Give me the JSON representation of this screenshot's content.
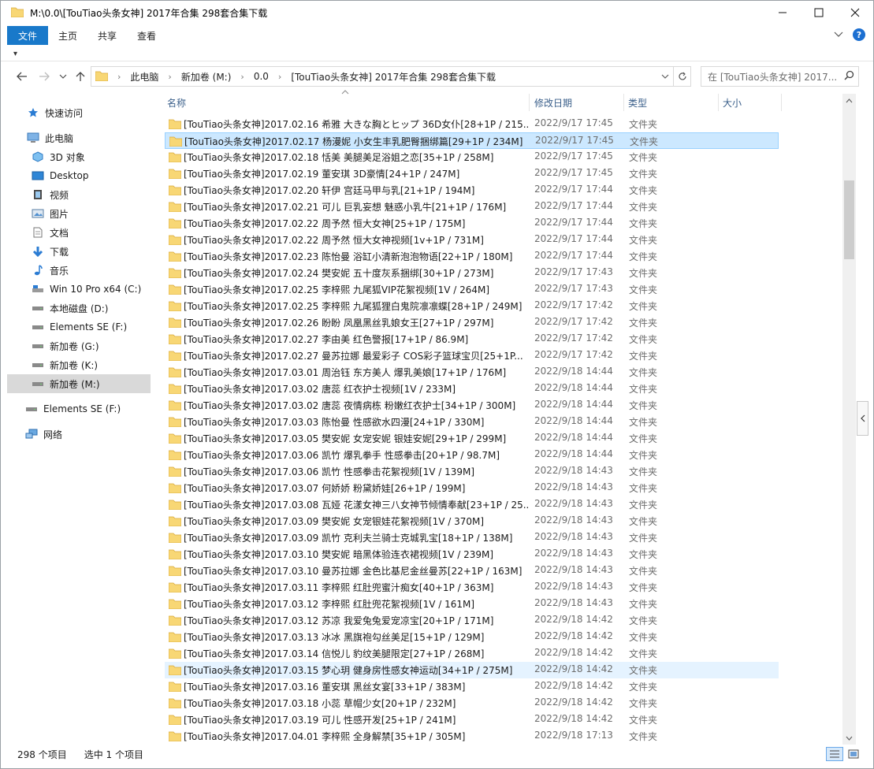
{
  "window": {
    "title": "M:\\0.0\\[TouTiao头条女神] 2017年合集 298套合集下载"
  },
  "ribbon": {
    "tabs": [
      "文件",
      "主页",
      "共享",
      "查看"
    ],
    "qat_label": "▾"
  },
  "address": {
    "crumbs": [
      "此电脑",
      "新加卷 (M:)",
      "0.0",
      "[TouTiao头条女神] 2017年合集 298套合集下载"
    ],
    "search_placeholder": "在 [TouTiao头条女神] 2017..."
  },
  "navpane": {
    "items": [
      {
        "label": "快速访问",
        "icon": "star-icon"
      },
      {
        "label": "此电脑",
        "icon": "computer-icon"
      },
      {
        "label": "3D 对象",
        "icon": "cube-icon"
      },
      {
        "label": "Desktop",
        "icon": "desktop-icon"
      },
      {
        "label": "视频",
        "icon": "video-icon"
      },
      {
        "label": "图片",
        "icon": "picture-icon"
      },
      {
        "label": "文档",
        "icon": "document-icon"
      },
      {
        "label": "下载",
        "icon": "download-icon"
      },
      {
        "label": "音乐",
        "icon": "music-icon"
      },
      {
        "label": "Win 10 Pro x64 (C:)",
        "icon": "system-drive-icon"
      },
      {
        "label": "本地磁盘 (D:)",
        "icon": "drive-icon"
      },
      {
        "label": "Elements SE (F:)",
        "icon": "drive-icon"
      },
      {
        "label": "新加卷 (G:)",
        "icon": "drive-icon"
      },
      {
        "label": "新加卷 (K:)",
        "icon": "drive-icon"
      },
      {
        "label": "新加卷 (M:)",
        "icon": "drive-icon"
      },
      {
        "label": "Elements SE (F:)",
        "icon": "drive-icon"
      },
      {
        "label": "网络",
        "icon": "network-icon"
      }
    ]
  },
  "columns": {
    "name": "名称",
    "date": "修改日期",
    "type": "类型",
    "size": "大小"
  },
  "files": [
    {
      "name": "[TouTiao头条女神]2017.02.16 希雅 大きな胸とヒップ 36D女仆[28+1P / 215...",
      "date": "2022/9/17 17:45",
      "type": "文件夹"
    },
    {
      "name": "[TouTiao头条女神]2017.02.17 杨漫妮 小女生丰乳肥臀捆绑篇[29+1P / 234M]",
      "date": "2022/9/17 17:45",
      "type": "文件夹"
    },
    {
      "name": "[TouTiao头条女神]2017.02.18 恬美 美腿美足浴姐之恋[35+1P / 258M]",
      "date": "2022/9/17 17:45",
      "type": "文件夹"
    },
    {
      "name": "[TouTiao头条女神]2017.02.19 董安琪 3D豪情[24+1P / 247M]",
      "date": "2022/9/17 17:45",
      "type": "文件夹"
    },
    {
      "name": "[TouTiao头条女神]2017.02.20 轩伊 宫廷马甲与乳[21+1P / 194M]",
      "date": "2022/9/17 17:44",
      "type": "文件夹"
    },
    {
      "name": "[TouTiao头条女神]2017.02.21 可儿 巨乳妄想 魅惑小乳牛[21+1P / 176M]",
      "date": "2022/9/17 17:44",
      "type": "文件夹"
    },
    {
      "name": "[TouTiao头条女神]2017.02.22 周予然 恒大女神[25+1P / 175M]",
      "date": "2022/9/17 17:44",
      "type": "文件夹"
    },
    {
      "name": "[TouTiao头条女神]2017.02.22 周予然 恒大女神视频[1v+1P / 731M]",
      "date": "2022/9/17 17:44",
      "type": "文件夹"
    },
    {
      "name": "[TouTiao头条女神]2017.02.23 陈怡曼 浴缸小清新泡泡物语[22+1P / 180M]",
      "date": "2022/9/17 17:44",
      "type": "文件夹"
    },
    {
      "name": "[TouTiao头条女神]2017.02.24 樊安妮 五十度灰系捆绑[30+1P / 273M]",
      "date": "2022/9/17 17:43",
      "type": "文件夹"
    },
    {
      "name": "[TouTiao头条女神]2017.02.25 李梓熙 九尾狐VIP花絮视频[1V / 264M]",
      "date": "2022/9/17 17:43",
      "type": "文件夹"
    },
    {
      "name": "[TouTiao头条女神]2017.02.25 李梓熙 九尾狐狸白鬼院凛凛蝶[28+1P / 249M]",
      "date": "2022/9/17 17:42",
      "type": "文件夹"
    },
    {
      "name": "[TouTiao头条女神]2017.02.26 盼盼 凤凰黑丝乳娘女王[27+1P / 297M]",
      "date": "2022/9/17 17:42",
      "type": "文件夹"
    },
    {
      "name": "[TouTiao头条女神]2017.02.27 李由美 红色警报[17+1P / 86.9M]",
      "date": "2022/9/17 17:42",
      "type": "文件夹"
    },
    {
      "name": "[TouTiao头条女神]2017.02.27 曼苏拉娜 最爱彩子 COS彩子篮球宝贝[25+1P...",
      "date": "2022/9/17 17:42",
      "type": "文件夹"
    },
    {
      "name": "[TouTiao头条女神]2017.03.01 周治钰 东方美人 爆乳美娘[17+1P / 176M]",
      "date": "2022/9/18 14:44",
      "type": "文件夹"
    },
    {
      "name": "[TouTiao头条女神]2017.03.02 唐蕊 红衣护士视频[1V / 233M]",
      "date": "2022/9/18 14:44",
      "type": "文件夹"
    },
    {
      "name": "[TouTiao头条女神]2017.03.02 唐蕊 夜情病栋 粉嫩红衣护士[34+1P / 300M]",
      "date": "2022/9/18 14:44",
      "type": "文件夹"
    },
    {
      "name": "[TouTiao头条女神]2017.03.03 陈怡曼 性感欲水四漫[24+1P / 330M]",
      "date": "2022/9/18 14:44",
      "type": "文件夹"
    },
    {
      "name": "[TouTiao头条女神]2017.03.05 樊安妮 女宠安妮 银娃安妮[29+1P / 299M]",
      "date": "2022/9/18 14:44",
      "type": "文件夹"
    },
    {
      "name": "[TouTiao头条女神]2017.03.06 凯竹 爆乳拳手 性感拳击[20+1P / 98.7M]",
      "date": "2022/9/18 14:44",
      "type": "文件夹"
    },
    {
      "name": "[TouTiao头条女神]2017.03.06 凯竹 性感拳击花絮视频[1V / 139M]",
      "date": "2022/9/18 14:43",
      "type": "文件夹"
    },
    {
      "name": "[TouTiao头条女神]2017.03.07 何娇娇 粉黛娇娃[26+1P / 199M]",
      "date": "2022/9/18 14:43",
      "type": "文件夹"
    },
    {
      "name": "[TouTiao头条女神]2017.03.08 瓦娅 花漾女神三八女神节倾情奉献[23+1P / 25...",
      "date": "2022/9/18 14:43",
      "type": "文件夹"
    },
    {
      "name": "[TouTiao头条女神]2017.03.09 樊安妮 女宠银娃花絮视频[1V / 370M]",
      "date": "2022/9/18 14:43",
      "type": "文件夹"
    },
    {
      "name": "[TouTiao头条女神]2017.03.09 凯竹 克利夫兰骑士克城乳宝[18+1P / 138M]",
      "date": "2022/9/18 14:43",
      "type": "文件夹"
    },
    {
      "name": "[TouTiao头条女神]2017.03.10 樊安妮 暗黑体验连衣裙视频[1V / 239M]",
      "date": "2022/9/18 14:43",
      "type": "文件夹"
    },
    {
      "name": "[TouTiao头条女神]2017.03.10 曼苏拉娜 金色比基尼金丝曼苏[22+1P / 163M]",
      "date": "2022/9/18 14:43",
      "type": "文件夹"
    },
    {
      "name": "[TouTiao头条女神]2017.03.11 李梓熙 红肚兜蜜汁痴女[40+1P / 363M]",
      "date": "2022/9/18 14:43",
      "type": "文件夹"
    },
    {
      "name": "[TouTiao头条女神]2017.03.12 李梓熙 红肚兜花絮视频[1V / 161M]",
      "date": "2022/9/18 14:43",
      "type": "文件夹"
    },
    {
      "name": "[TouTiao头条女神]2017.03.12 苏凉 我爱兔兔爱宠凉宝[20+1P / 171M]",
      "date": "2022/9/18 14:42",
      "type": "文件夹"
    },
    {
      "name": "[TouTiao头条女神]2017.03.13 冰冰 黑旗袍勾丝美足[15+1P / 129M]",
      "date": "2022/9/18 14:42",
      "type": "文件夹"
    },
    {
      "name": "[TouTiao头条女神]2017.03.14 信悦儿 豹纹美腿限定[27+1P / 268M]",
      "date": "2022/9/18 14:42",
      "type": "文件夹"
    },
    {
      "name": "[TouTiao头条女神]2017.03.15 梦心玥 健身房性感女神运动[34+1P / 275M]",
      "date": "2022/9/18 14:42",
      "type": "文件夹"
    },
    {
      "name": "[TouTiao头条女神]2017.03.16 董安琪 黑丝女宴[33+1P / 383M]",
      "date": "2022/9/18 14:42",
      "type": "文件夹"
    },
    {
      "name": "[TouTiao头条女神]2017.03.18 小蕊 草帽少女[20+1P / 232M]",
      "date": "2022/9/18 14:42",
      "type": "文件夹"
    },
    {
      "name": "[TouTiao头条女神]2017.03.19 可儿 性感开发[25+1P / 241M]",
      "date": "2022/9/18 14:42",
      "type": "文件夹"
    },
    {
      "name": "[TouTiao头条女神]2017.04.01 李梓熙 全身解禁[35+1P / 305M]",
      "date": "2022/9/18 17:13",
      "type": "文件夹"
    }
  ],
  "selected_row": 1,
  "hover_row": 33,
  "status": {
    "count": "298 个项目",
    "selected": "选中 1 个项目"
  },
  "colors": {
    "accent": "#1979ca",
    "folder": "#f8d775",
    "selected_bg": "#cce8ff",
    "hover_bg": "#e5f3ff"
  }
}
